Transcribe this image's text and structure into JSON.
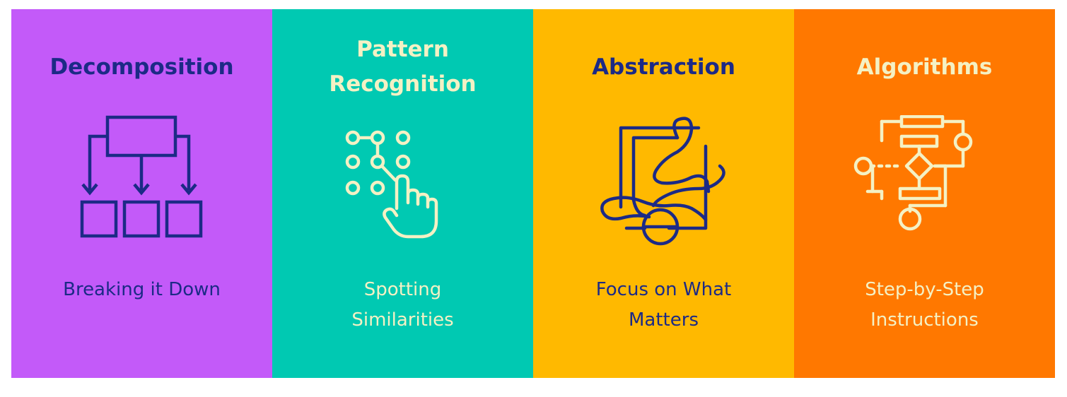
{
  "colors": {
    "purple": "#c35af9",
    "teal": "#00c9b2",
    "yellow": "#ffb900",
    "orange": "#ff7800",
    "navy": "#1c2a86",
    "cream": "#f4f1c4"
  },
  "panels": [
    {
      "title": "Decomposition",
      "caption": "Breaking it Down",
      "icon": "hierarchy-icon"
    },
    {
      "title": "Pattern Recognition",
      "caption": "Spotting Similarities",
      "icon": "pattern-touch-icon"
    },
    {
      "title": "Abstraction",
      "caption": "Focus on What Matters",
      "icon": "abstract-shapes-icon"
    },
    {
      "title": "Algorithms",
      "caption": "Step-by-Step Instructions",
      "icon": "flowchart-icon"
    }
  ]
}
